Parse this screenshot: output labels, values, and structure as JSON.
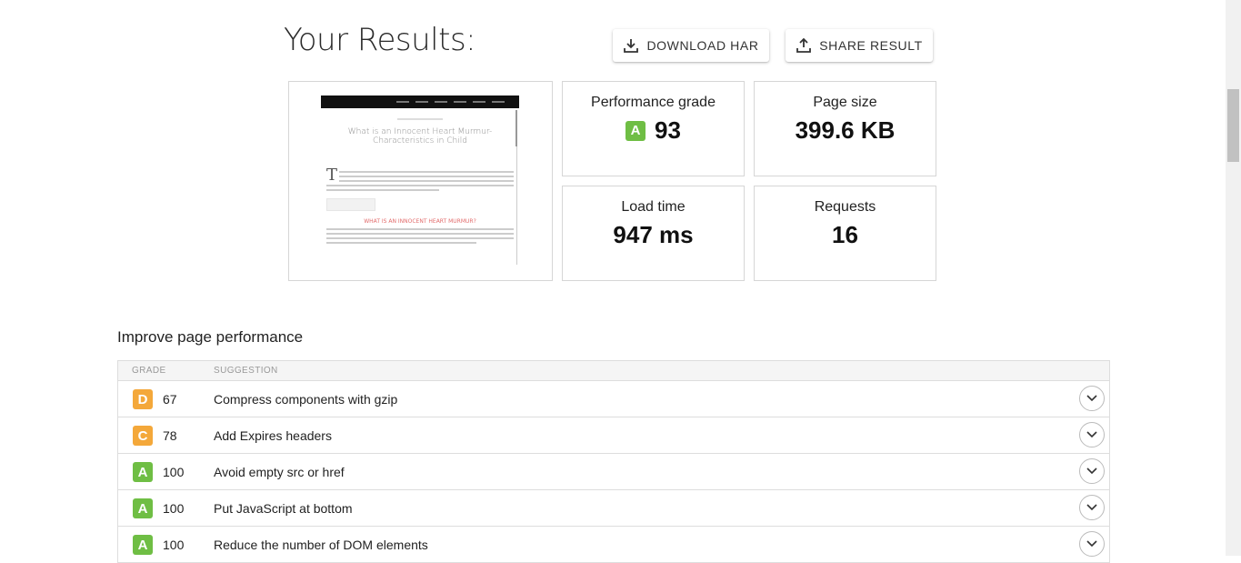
{
  "page": {
    "title": "Your Results:"
  },
  "actions": {
    "download_label": "DOWNLOAD HAR",
    "share_label": "SHARE RESULT"
  },
  "screenshot": {
    "headline": "What is an Innocent Heart Murmur-Characteristics in Child",
    "dropcap": "T",
    "section_heading": "WHAT IS AN INNOCENT HEART MURMUR?"
  },
  "metrics": {
    "performance": {
      "label": "Performance grade",
      "grade": "A",
      "value": "93",
      "grade_color": "#6fbe44"
    },
    "page_size": {
      "label": "Page size",
      "value": "399.6 KB"
    },
    "load_time": {
      "label": "Load time",
      "value": "947 ms"
    },
    "requests": {
      "label": "Requests",
      "value": "16"
    }
  },
  "improve": {
    "title": "Improve page performance",
    "columns": {
      "grade": "GRADE",
      "suggestion": "SUGGESTION"
    },
    "rows": [
      {
        "grade": "D",
        "score": "67",
        "suggestion": "Compress components with gzip",
        "color": "#f4a83a"
      },
      {
        "grade": "C",
        "score": "78",
        "suggestion": "Add Expires headers",
        "color": "#f4a83a"
      },
      {
        "grade": "A",
        "score": "100",
        "suggestion": "Avoid empty src or href",
        "color": "#6fbe44"
      },
      {
        "grade": "A",
        "score": "100",
        "suggestion": "Put JavaScript at bottom",
        "color": "#6fbe44"
      },
      {
        "grade": "A",
        "score": "100",
        "suggestion": "Reduce the number of DOM elements",
        "color": "#6fbe44"
      }
    ]
  },
  "icons": {
    "download": "download-icon",
    "share": "share-icon",
    "expand": "chevron-down-icon"
  }
}
